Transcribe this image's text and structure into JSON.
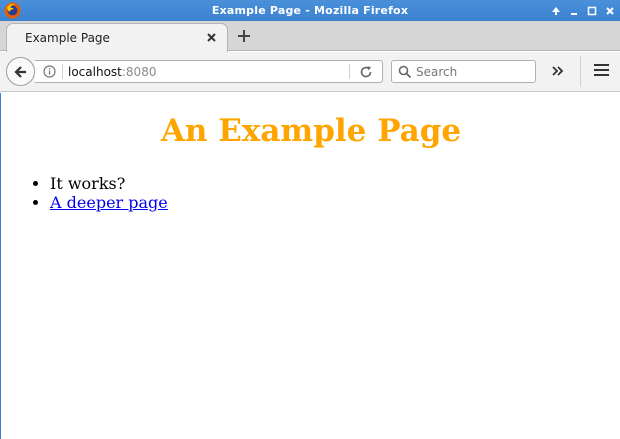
{
  "window": {
    "title": "Example Page - Mozilla Firefox"
  },
  "tabs": [
    {
      "label": "Example Page"
    }
  ],
  "navbar": {
    "url_host": "localhost",
    "url_port": ":8080",
    "search_placeholder": "Search"
  },
  "page": {
    "heading": "An Example Page",
    "heading_color": "#ffa500",
    "items": [
      {
        "text": "It works?"
      },
      {
        "text": "A deeper page"
      }
    ]
  },
  "icons": {
    "window_controls": [
      "up-arrow-icon",
      "minimize-icon",
      "maximize-icon",
      "close-icon"
    ]
  }
}
